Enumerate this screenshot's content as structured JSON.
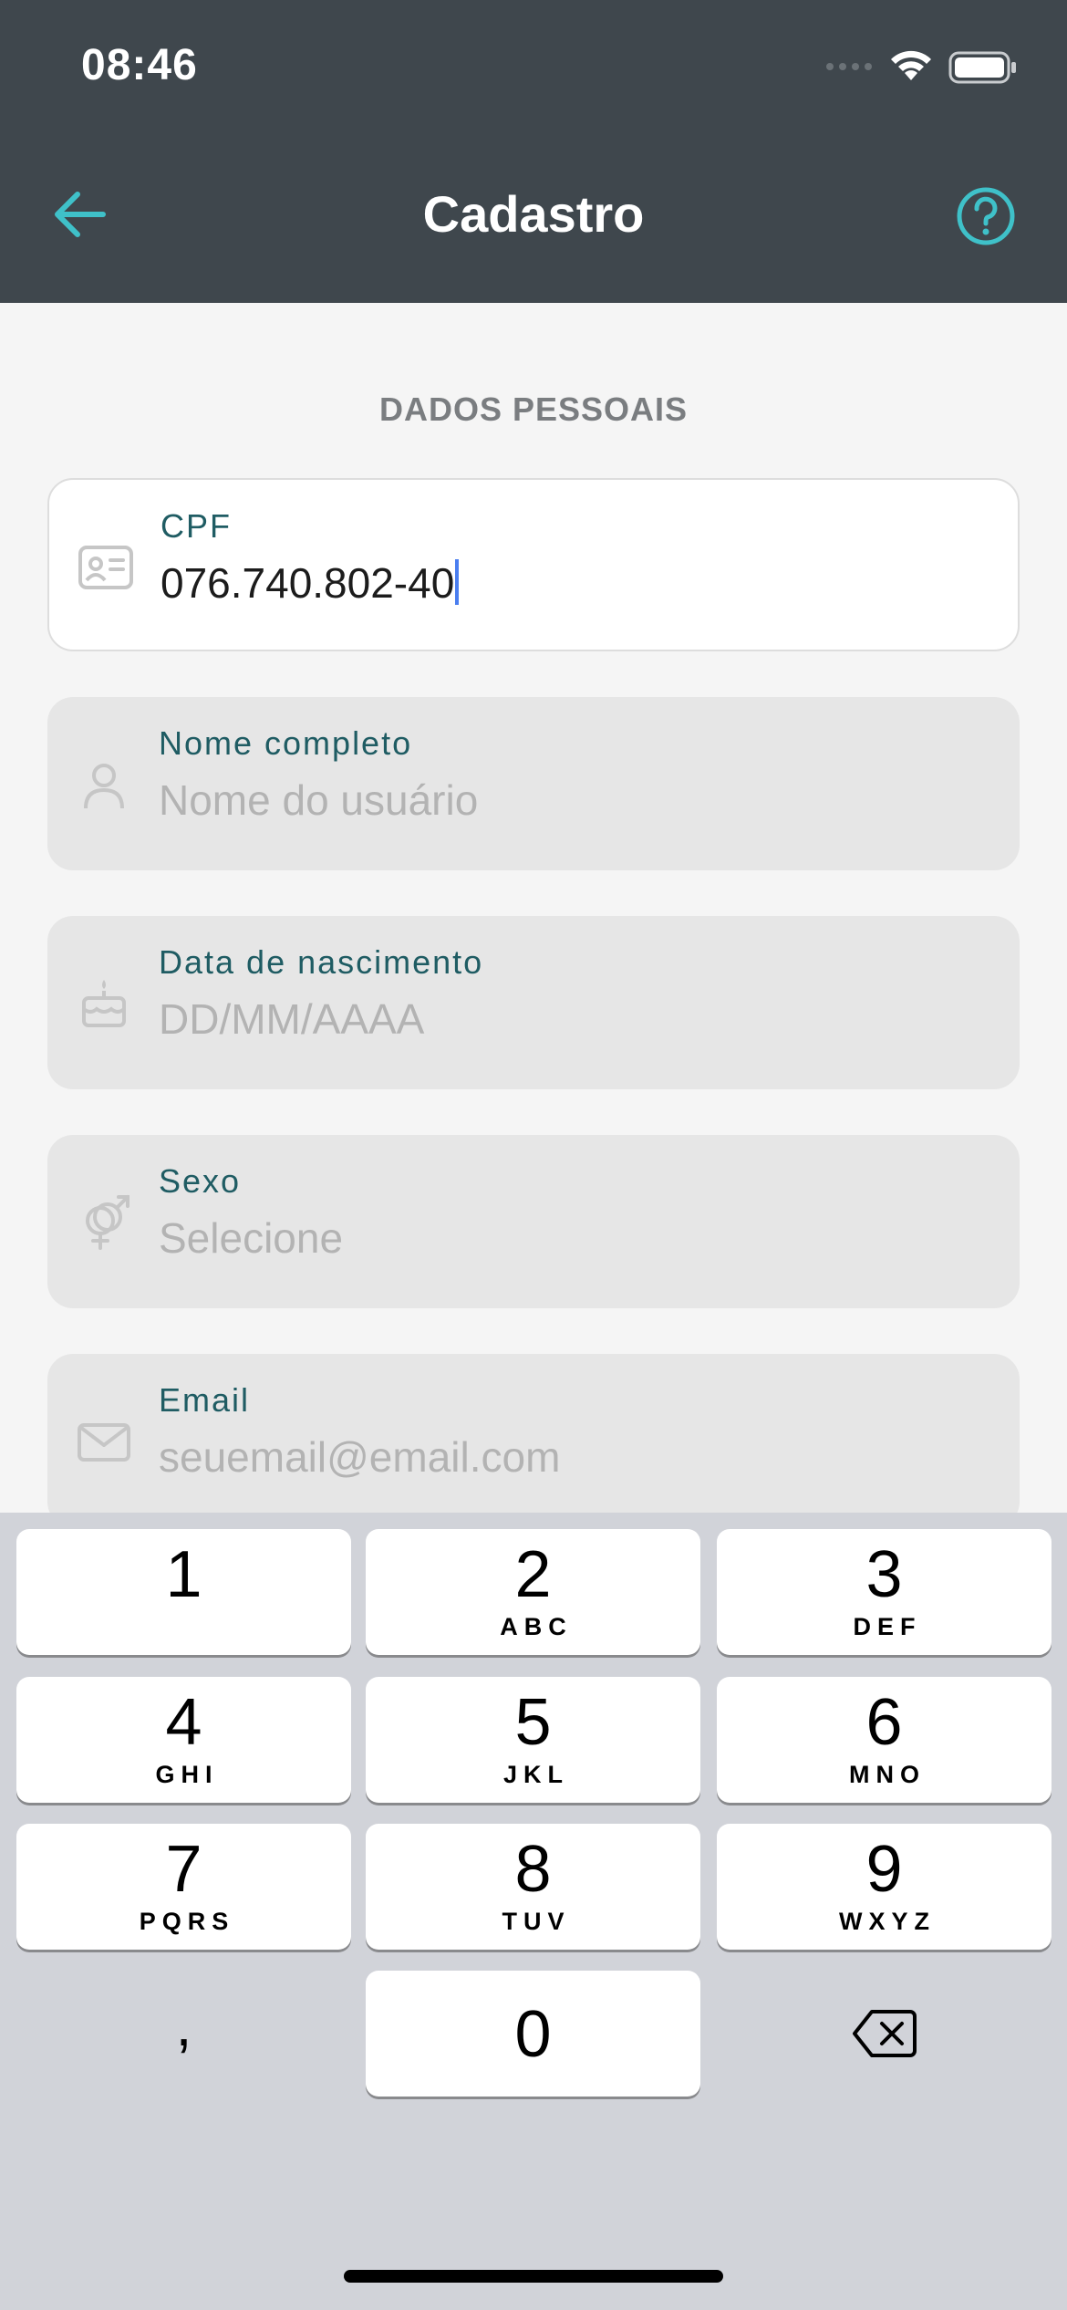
{
  "status_bar": {
    "time": "08:46",
    "signal_icon": "signal-dots-icon",
    "wifi_icon": "wifi-icon",
    "battery_icon": "battery-icon"
  },
  "header": {
    "title": "Cadastro",
    "back_icon": "arrow-left-icon",
    "help_icon": "question-circle-icon"
  },
  "form": {
    "section_title": "DADOS PESSOAIS",
    "fields": [
      {
        "label": "CPF",
        "value": "076.740.802-40",
        "placeholder": "",
        "icon": "id-card-icon",
        "active": true
      },
      {
        "label": "Nome completo",
        "value": "",
        "placeholder": "Nome do usuário",
        "icon": "user-icon",
        "active": false
      },
      {
        "label": "Data de nascimento",
        "value": "",
        "placeholder": "DD/MM/AAAA",
        "icon": "cake-icon",
        "active": false
      },
      {
        "label": "Sexo",
        "value": "",
        "placeholder": "Selecione",
        "icon": "gender-icon",
        "active": false
      },
      {
        "label": "Email",
        "value": "",
        "placeholder": "seuemail@email.com",
        "icon": "mail-icon",
        "active": false
      }
    ]
  },
  "keyboard": {
    "keys": [
      {
        "digit": "1",
        "letters": ""
      },
      {
        "digit": "2",
        "letters": "ABC"
      },
      {
        "digit": "3",
        "letters": "DEF"
      },
      {
        "digit": "4",
        "letters": "GHI"
      },
      {
        "digit": "5",
        "letters": "JKL"
      },
      {
        "digit": "6",
        "letters": "MNO"
      },
      {
        "digit": "7",
        "letters": "PQRS"
      },
      {
        "digit": "8",
        "letters": "TUV"
      },
      {
        "digit": "9",
        "letters": "WXYZ"
      },
      {
        "digit": "0",
        "letters": ""
      }
    ],
    "comma": ",",
    "delete_icon": "backspace-icon"
  },
  "colors": {
    "header_bg": "#3f474d",
    "accent": "#3fc1c9",
    "label": "#1f5c63",
    "caret": "#4a7ef0"
  }
}
